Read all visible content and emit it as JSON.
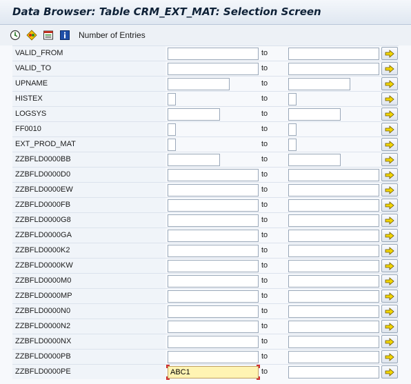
{
  "window": {
    "title": "Data Browser: Table CRM_EXT_MAT: Selection Screen"
  },
  "toolbar": {
    "number_of_entries_label": "Number of Entries",
    "icons": [
      "execute-icon",
      "reset-icon",
      "variant-icon",
      "info-icon"
    ]
  },
  "selection": {
    "to_label": "to",
    "rows": [
      {
        "field": "VALID_FROM",
        "low": "",
        "high": ""
      },
      {
        "field": "VALID_TO",
        "low": "",
        "high": ""
      },
      {
        "field": "UPNAME",
        "low": "",
        "high": ""
      },
      {
        "field": "HISTEX",
        "low": "",
        "high": ""
      },
      {
        "field": "LOGSYS",
        "low": "",
        "high": ""
      },
      {
        "field": "FF0010",
        "low": "",
        "high": ""
      },
      {
        "field": "EXT_PROD_MAT",
        "low": "",
        "high": ""
      },
      {
        "field": "ZZBFLD0000BB",
        "low": "",
        "high": ""
      },
      {
        "field": "ZZBFLD0000D0",
        "low": "",
        "high": ""
      },
      {
        "field": "ZZBFLD0000EW",
        "low": "",
        "high": ""
      },
      {
        "field": "ZZBFLD0000FB",
        "low": "",
        "high": ""
      },
      {
        "field": "ZZBFLD0000G8",
        "low": "",
        "high": ""
      },
      {
        "field": "ZZBFLD0000GA",
        "low": "",
        "high": ""
      },
      {
        "field": "ZZBFLD0000K2",
        "low": "",
        "high": ""
      },
      {
        "field": "ZZBFLD0000KW",
        "low": "",
        "high": ""
      },
      {
        "field": "ZZBFLD0000M0",
        "low": "",
        "high": ""
      },
      {
        "field": "ZZBFLD0000MP",
        "low": "",
        "high": ""
      },
      {
        "field": "ZZBFLD0000N0",
        "low": "",
        "high": ""
      },
      {
        "field": "ZZBFLD0000N2",
        "low": "",
        "high": ""
      },
      {
        "field": "ZZBFLD0000NX",
        "low": "",
        "high": ""
      },
      {
        "field": "ZZBFLD0000PB",
        "low": "",
        "high": ""
      },
      {
        "field": "ZZBFLD0000PE",
        "low": "ABC1",
        "high": ""
      }
    ]
  },
  "colors": {
    "active_field_bg": "#fff4b3",
    "more_arrow": "#f2d600"
  }
}
